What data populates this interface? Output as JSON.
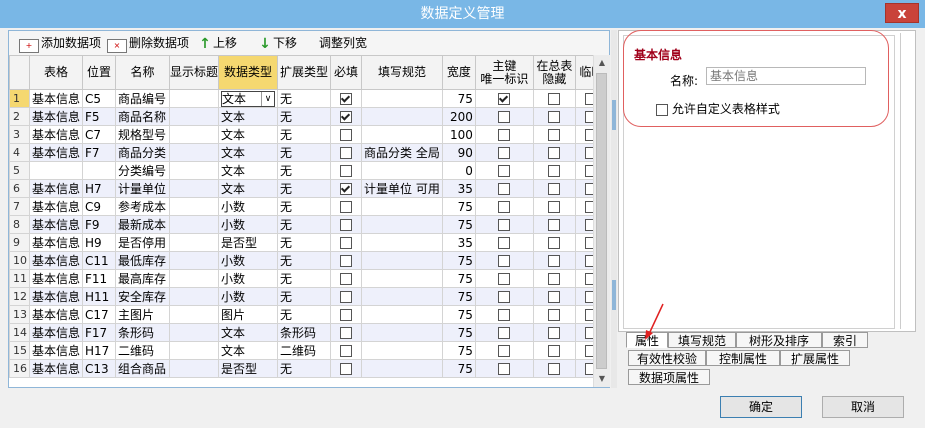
{
  "window": {
    "title": "数据定义管理",
    "close_label": "x"
  },
  "toolbar": {
    "add_label": "添加数据项",
    "delete_label": "删除数据项",
    "up_label": "上移",
    "down_label": "下移",
    "adjust_label": "调整列宽"
  },
  "grid": {
    "columns": [
      "表格",
      "位置",
      "名称",
      "显示标题",
      "数据类型",
      "扩展类型",
      "必填",
      "填写规范",
      "宽度",
      "主键\n唯一标识",
      "在总表\n隐藏",
      "临时"
    ],
    "rows": [
      {
        "n": "1",
        "table": "基本信息",
        "pos": "C5",
        "name": "商品编号",
        "title": "",
        "dtype": "文本",
        "ext": "无",
        "req": true,
        "rule": "",
        "width": "75",
        "pk": true,
        "hide": false,
        "temp": false
      },
      {
        "n": "2",
        "table": "基本信息",
        "pos": "F5",
        "name": "商品名称",
        "title": "",
        "dtype": "文本",
        "ext": "无",
        "req": true,
        "rule": "",
        "width": "200",
        "pk": false,
        "hide": false,
        "temp": false
      },
      {
        "n": "3",
        "table": "基本信息",
        "pos": "C7",
        "name": "规格型号",
        "title": "",
        "dtype": "文本",
        "ext": "无",
        "req": false,
        "rule": "",
        "width": "100",
        "pk": false,
        "hide": false,
        "temp": false
      },
      {
        "n": "4",
        "table": "基本信息",
        "pos": "F7",
        "name": "商品分类",
        "title": "",
        "dtype": "文本",
        "ext": "无",
        "req": false,
        "rule": "商品分类 全局",
        "width": "90",
        "pk": false,
        "hide": false,
        "temp": false
      },
      {
        "n": "5",
        "table": "",
        "pos": "",
        "name": "分类编号",
        "title": "",
        "dtype": "文本",
        "ext": "无",
        "req": false,
        "rule": "",
        "width": "0",
        "pk": false,
        "hide": false,
        "temp": false
      },
      {
        "n": "6",
        "table": "基本信息",
        "pos": "H7",
        "name": "计量单位",
        "title": "",
        "dtype": "文本",
        "ext": "无",
        "req": true,
        "rule": "计量单位 可用",
        "width": "35",
        "pk": false,
        "hide": false,
        "temp": false
      },
      {
        "n": "7",
        "table": "基本信息",
        "pos": "C9",
        "name": "参考成本",
        "title": "",
        "dtype": "小数",
        "ext": "无",
        "req": false,
        "rule": "",
        "width": "75",
        "pk": false,
        "hide": false,
        "temp": false
      },
      {
        "n": "8",
        "table": "基本信息",
        "pos": "F9",
        "name": "最新成本",
        "title": "",
        "dtype": "小数",
        "ext": "无",
        "req": false,
        "rule": "",
        "width": "75",
        "pk": false,
        "hide": false,
        "temp": false
      },
      {
        "n": "9",
        "table": "基本信息",
        "pos": "H9",
        "name": "是否停用",
        "title": "",
        "dtype": "是否型",
        "ext": "无",
        "req": false,
        "rule": "",
        "width": "35",
        "pk": false,
        "hide": false,
        "temp": false
      },
      {
        "n": "10",
        "table": "基本信息",
        "pos": "C11",
        "name": "最低库存",
        "title": "",
        "dtype": "小数",
        "ext": "无",
        "req": false,
        "rule": "",
        "width": "75",
        "pk": false,
        "hide": false,
        "temp": false
      },
      {
        "n": "11",
        "table": "基本信息",
        "pos": "F11",
        "name": "最高库存",
        "title": "",
        "dtype": "小数",
        "ext": "无",
        "req": false,
        "rule": "",
        "width": "75",
        "pk": false,
        "hide": false,
        "temp": false
      },
      {
        "n": "12",
        "table": "基本信息",
        "pos": "H11",
        "name": "安全库存",
        "title": "",
        "dtype": "小数",
        "ext": "无",
        "req": false,
        "rule": "",
        "width": "75",
        "pk": false,
        "hide": false,
        "temp": false
      },
      {
        "n": "13",
        "table": "基本信息",
        "pos": "C17",
        "name": "主图片",
        "title": "",
        "dtype": "图片",
        "ext": "无",
        "req": false,
        "rule": "",
        "width": "75",
        "pk": false,
        "hide": false,
        "temp": false
      },
      {
        "n": "14",
        "table": "基本信息",
        "pos": "F17",
        "name": "条形码",
        "title": "",
        "dtype": "文本",
        "ext": "条形码",
        "req": false,
        "rule": "",
        "width": "75",
        "pk": false,
        "hide": false,
        "temp": false
      },
      {
        "n": "15",
        "table": "基本信息",
        "pos": "H17",
        "name": "二维码",
        "title": "",
        "dtype": "文本",
        "ext": "二维码",
        "req": false,
        "rule": "",
        "width": "75",
        "pk": false,
        "hide": false,
        "temp": false
      },
      {
        "n": "16",
        "table": "基本信息",
        "pos": "C13",
        "name": "组合商品",
        "title": "",
        "dtype": "是否型",
        "ext": "无",
        "req": false,
        "rule": "",
        "width": "75",
        "pk": false,
        "hide": false,
        "temp": false
      }
    ]
  },
  "props": {
    "group_title": "基本信息",
    "name_label": "名称:",
    "name_value": "基本信息",
    "allow_custom_label": "允许自定义表格样式"
  },
  "tabs": {
    "row1": [
      "属性",
      "填写规范",
      "树形及排序",
      "索引"
    ],
    "row2": [
      "有效性校验",
      "控制属性",
      "扩展属性"
    ],
    "row3": [
      "数据项属性"
    ]
  },
  "buttons": {
    "ok": "确定",
    "cancel": "取消"
  },
  "colors": {
    "titlebar": "#79b7e6",
    "highlight": "#f5d870",
    "annotation": "#e02020"
  }
}
